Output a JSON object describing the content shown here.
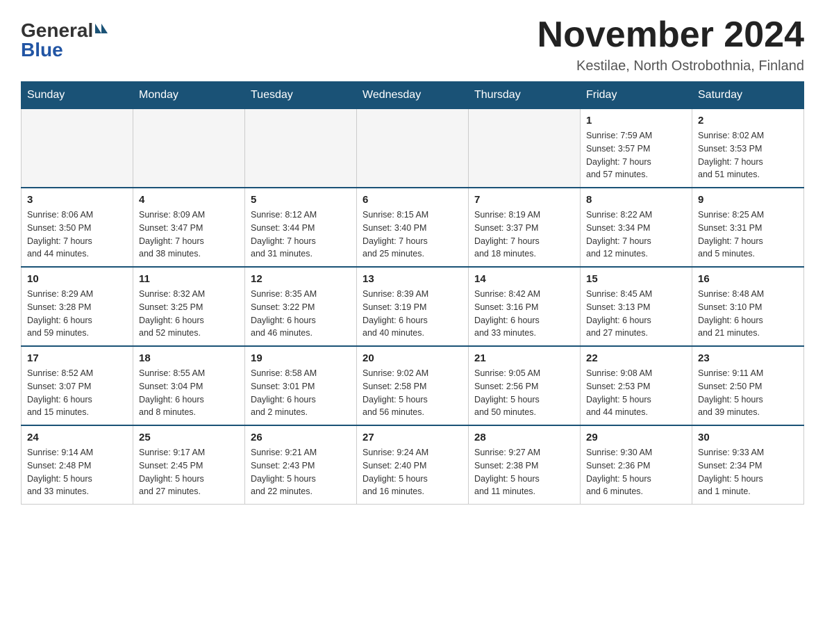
{
  "logo": {
    "general": "General",
    "blue": "Blue"
  },
  "title": "November 2024",
  "location": "Kestilae, North Ostrobothnia, Finland",
  "days_of_week": [
    "Sunday",
    "Monday",
    "Tuesday",
    "Wednesday",
    "Thursday",
    "Friday",
    "Saturday"
  ],
  "weeks": [
    [
      {
        "day": "",
        "info": ""
      },
      {
        "day": "",
        "info": ""
      },
      {
        "day": "",
        "info": ""
      },
      {
        "day": "",
        "info": ""
      },
      {
        "day": "",
        "info": ""
      },
      {
        "day": "1",
        "info": "Sunrise: 7:59 AM\nSunset: 3:57 PM\nDaylight: 7 hours\nand 57 minutes."
      },
      {
        "day": "2",
        "info": "Sunrise: 8:02 AM\nSunset: 3:53 PM\nDaylight: 7 hours\nand 51 minutes."
      }
    ],
    [
      {
        "day": "3",
        "info": "Sunrise: 8:06 AM\nSunset: 3:50 PM\nDaylight: 7 hours\nand 44 minutes."
      },
      {
        "day": "4",
        "info": "Sunrise: 8:09 AM\nSunset: 3:47 PM\nDaylight: 7 hours\nand 38 minutes."
      },
      {
        "day": "5",
        "info": "Sunrise: 8:12 AM\nSunset: 3:44 PM\nDaylight: 7 hours\nand 31 minutes."
      },
      {
        "day": "6",
        "info": "Sunrise: 8:15 AM\nSunset: 3:40 PM\nDaylight: 7 hours\nand 25 minutes."
      },
      {
        "day": "7",
        "info": "Sunrise: 8:19 AM\nSunset: 3:37 PM\nDaylight: 7 hours\nand 18 minutes."
      },
      {
        "day": "8",
        "info": "Sunrise: 8:22 AM\nSunset: 3:34 PM\nDaylight: 7 hours\nand 12 minutes."
      },
      {
        "day": "9",
        "info": "Sunrise: 8:25 AM\nSunset: 3:31 PM\nDaylight: 7 hours\nand 5 minutes."
      }
    ],
    [
      {
        "day": "10",
        "info": "Sunrise: 8:29 AM\nSunset: 3:28 PM\nDaylight: 6 hours\nand 59 minutes."
      },
      {
        "day": "11",
        "info": "Sunrise: 8:32 AM\nSunset: 3:25 PM\nDaylight: 6 hours\nand 52 minutes."
      },
      {
        "day": "12",
        "info": "Sunrise: 8:35 AM\nSunset: 3:22 PM\nDaylight: 6 hours\nand 46 minutes."
      },
      {
        "day": "13",
        "info": "Sunrise: 8:39 AM\nSunset: 3:19 PM\nDaylight: 6 hours\nand 40 minutes."
      },
      {
        "day": "14",
        "info": "Sunrise: 8:42 AM\nSunset: 3:16 PM\nDaylight: 6 hours\nand 33 minutes."
      },
      {
        "day": "15",
        "info": "Sunrise: 8:45 AM\nSunset: 3:13 PM\nDaylight: 6 hours\nand 27 minutes."
      },
      {
        "day": "16",
        "info": "Sunrise: 8:48 AM\nSunset: 3:10 PM\nDaylight: 6 hours\nand 21 minutes."
      }
    ],
    [
      {
        "day": "17",
        "info": "Sunrise: 8:52 AM\nSunset: 3:07 PM\nDaylight: 6 hours\nand 15 minutes."
      },
      {
        "day": "18",
        "info": "Sunrise: 8:55 AM\nSunset: 3:04 PM\nDaylight: 6 hours\nand 8 minutes."
      },
      {
        "day": "19",
        "info": "Sunrise: 8:58 AM\nSunset: 3:01 PM\nDaylight: 6 hours\nand 2 minutes."
      },
      {
        "day": "20",
        "info": "Sunrise: 9:02 AM\nSunset: 2:58 PM\nDaylight: 5 hours\nand 56 minutes."
      },
      {
        "day": "21",
        "info": "Sunrise: 9:05 AM\nSunset: 2:56 PM\nDaylight: 5 hours\nand 50 minutes."
      },
      {
        "day": "22",
        "info": "Sunrise: 9:08 AM\nSunset: 2:53 PM\nDaylight: 5 hours\nand 44 minutes."
      },
      {
        "day": "23",
        "info": "Sunrise: 9:11 AM\nSunset: 2:50 PM\nDaylight: 5 hours\nand 39 minutes."
      }
    ],
    [
      {
        "day": "24",
        "info": "Sunrise: 9:14 AM\nSunset: 2:48 PM\nDaylight: 5 hours\nand 33 minutes."
      },
      {
        "day": "25",
        "info": "Sunrise: 9:17 AM\nSunset: 2:45 PM\nDaylight: 5 hours\nand 27 minutes."
      },
      {
        "day": "26",
        "info": "Sunrise: 9:21 AM\nSunset: 2:43 PM\nDaylight: 5 hours\nand 22 minutes."
      },
      {
        "day": "27",
        "info": "Sunrise: 9:24 AM\nSunset: 2:40 PM\nDaylight: 5 hours\nand 16 minutes."
      },
      {
        "day": "28",
        "info": "Sunrise: 9:27 AM\nSunset: 2:38 PM\nDaylight: 5 hours\nand 11 minutes."
      },
      {
        "day": "29",
        "info": "Sunrise: 9:30 AM\nSunset: 2:36 PM\nDaylight: 5 hours\nand 6 minutes."
      },
      {
        "day": "30",
        "info": "Sunrise: 9:33 AM\nSunset: 2:34 PM\nDaylight: 5 hours\nand 1 minute."
      }
    ]
  ]
}
